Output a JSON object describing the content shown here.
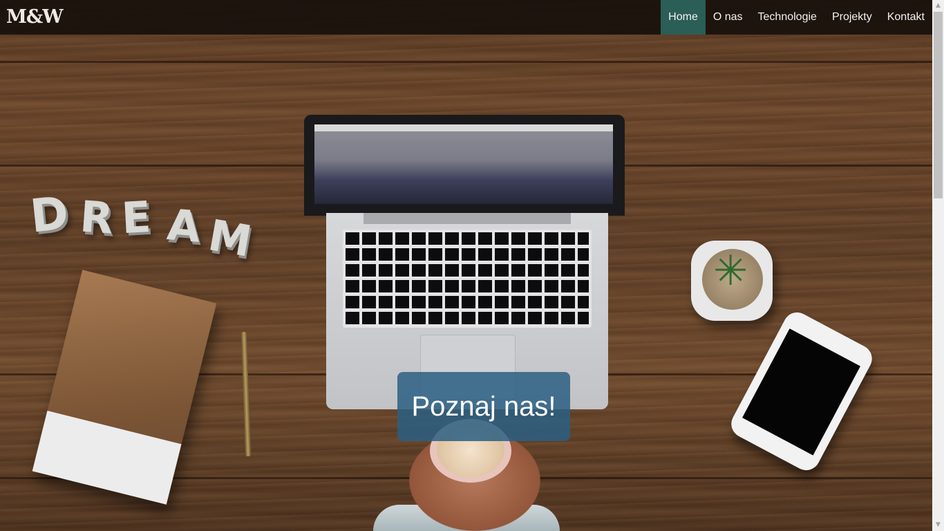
{
  "brand": {
    "logo_text": "M&W"
  },
  "nav": {
    "items": [
      {
        "label": "Home",
        "active": true
      },
      {
        "label": "O nas",
        "active": false
      },
      {
        "label": "Technologie",
        "active": false
      },
      {
        "label": "Projekty",
        "active": false
      },
      {
        "label": "Kontakt",
        "active": false
      }
    ]
  },
  "hero": {
    "decor_letters": [
      "D",
      "R",
      "E",
      "A",
      "M"
    ],
    "cta_label": "Poznaj nas!"
  },
  "colors": {
    "navbar_bg": "#18100c",
    "nav_active": "#2a5e56",
    "cta_bg": "#2c5f82",
    "text": "#ffffff"
  },
  "icons": {
    "scroll_up": "arrow-up-icon",
    "scroll_down": "arrow-down-icon"
  }
}
